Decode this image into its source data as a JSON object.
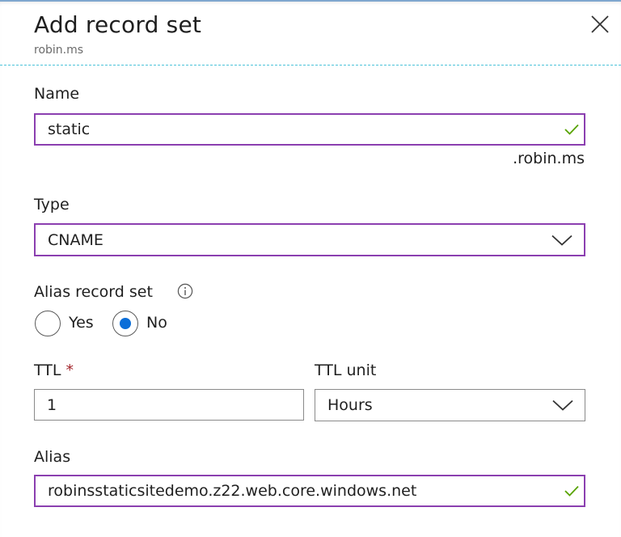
{
  "header": {
    "title": "Add record set",
    "subtitle": "robin.ms"
  },
  "name": {
    "label": "Name",
    "value": "static",
    "suffix": ".robin.ms"
  },
  "type": {
    "label": "Type",
    "selected": "CNAME"
  },
  "alias_record_set": {
    "label": "Alias record set",
    "options": [
      "Yes",
      "No"
    ],
    "selected": "No"
  },
  "ttl": {
    "label": "TTL",
    "required_marker": "*",
    "value": "1"
  },
  "ttl_unit": {
    "label": "TTL unit",
    "selected": "Hours"
  },
  "alias": {
    "label": "Alias",
    "value": "robinsstaticsitedemo.z22.web.core.windows.net"
  },
  "colors": {
    "valid_border": "#8b3fb0",
    "check": "#57a300",
    "radio_selected": "#0b6ed8",
    "required": "#a4262c",
    "header_divider": "#4cc3d9"
  }
}
